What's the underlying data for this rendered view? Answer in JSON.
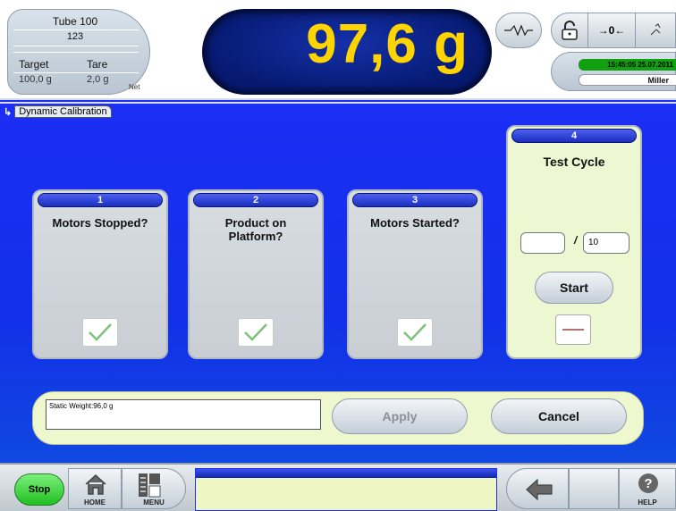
{
  "header": {
    "product_name": "Tube 100",
    "product_number": "123",
    "target_label": "Target",
    "target_value": "100,0 g",
    "tare_label": "Tare",
    "tare_value": "2,0 g",
    "net_label": "Net",
    "weight": "97,6 g",
    "zero_label": "→0←",
    "datetime": "15:45:05 25.07.2011",
    "user": "Miller"
  },
  "breadcrumb": {
    "page": "Dynamic Calibration"
  },
  "steps": [
    {
      "number": "1",
      "title": "Motors Stopped?",
      "checked": true
    },
    {
      "number": "2",
      "title": "Product on Platform?",
      "checked": true
    },
    {
      "number": "3",
      "title": "Motors Started?",
      "checked": true
    },
    {
      "number": "4",
      "title": "Test Cycle",
      "cycle_current": "",
      "cycle_separator": "/",
      "cycle_total": "10",
      "start_label": "Start"
    }
  ],
  "action_bar": {
    "status_text": "Static Weight:96,0 g",
    "apply_label": "Apply",
    "cancel_label": "Cancel"
  },
  "footer": {
    "stop_label": "Stop",
    "home_label": "HOME",
    "menu_label": "MENU",
    "help_label": "HELP"
  },
  "colors": {
    "main_blue": "#1b2ef5",
    "weight_yellow": "#ffd400",
    "active_panel": "#edf7d2",
    "stop_green": "#20c020"
  },
  "icons": [
    "filter-icon",
    "lock-icon",
    "zero-icon",
    "tool-icon",
    "home-icon",
    "menu-icon",
    "back-arrow-icon",
    "help-icon",
    "checkmark-icon"
  ]
}
